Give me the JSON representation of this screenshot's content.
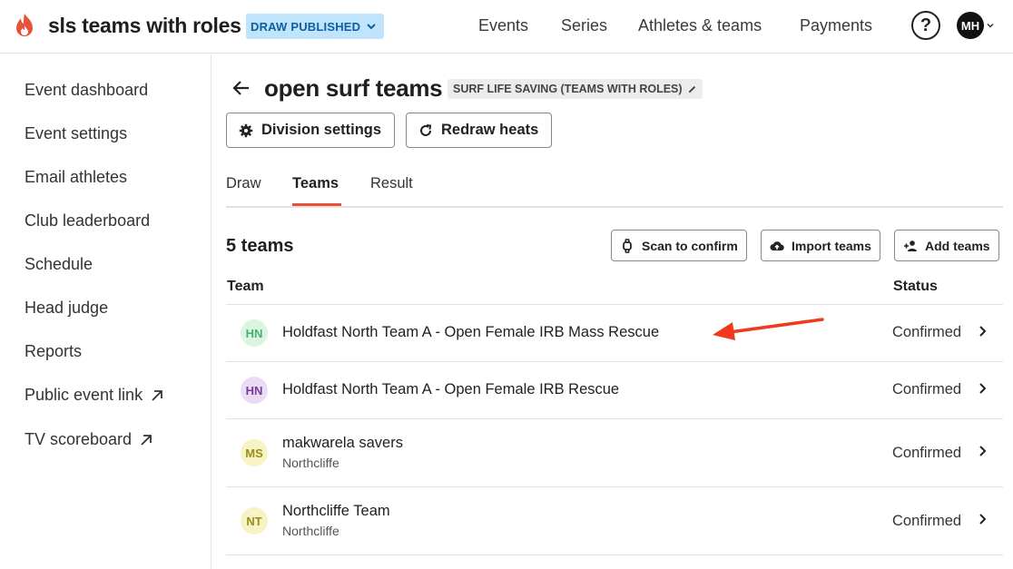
{
  "header": {
    "app_title": "sls teams with roles",
    "status": "DRAW PUBLISHED",
    "nav": [
      "Events",
      "Series",
      "Athletes & teams",
      "Payments"
    ],
    "help_icon": "?",
    "avatar_initials": "MH"
  },
  "sidebar": {
    "items": [
      "Event dashboard",
      "Event settings",
      "Email athletes",
      "Club leaderboard",
      "Schedule",
      "Head judge",
      "Reports",
      "Public event link",
      "TV scoreboard"
    ]
  },
  "division": {
    "title": "open surf teams",
    "type_tag": "SURF LIFE SAVING (TEAMS WITH ROLES)",
    "settings_button": "Division settings",
    "redraw_button": "Redraw heats"
  },
  "tabs": [
    "Draw",
    "Teams",
    "Result"
  ],
  "teams": {
    "count_label": "5 teams",
    "scan_button": "Scan to confirm",
    "import_button": "Import teams",
    "add_button": "Add teams",
    "col_team": "Team",
    "col_status": "Status",
    "rows": [
      {
        "initials": "HN",
        "name": "Holdfast North Team A - Open Female IRB Mass Rescue",
        "club": "",
        "status": "Confirmed"
      },
      {
        "initials": "HN",
        "name": "Holdfast North Team A - Open Female IRB Rescue",
        "club": "",
        "status": "Confirmed"
      },
      {
        "initials": "MS",
        "name": "makwarela savers",
        "club": "Northcliffe",
        "status": "Confirmed"
      },
      {
        "initials": "NT",
        "name": "Northcliffe Team",
        "club": "Northcliffe",
        "status": "Confirmed"
      }
    ]
  },
  "colors": {
    "accent": "#e8513a",
    "status_pill_bg": "#bfe4fb",
    "status_pill_text": "#0d5fa3",
    "avatar_green_bg": "#dcf5e3",
    "avatar_purple_bg": "#eadcf2",
    "avatar_yellow_bg": "#f8f3c4"
  }
}
